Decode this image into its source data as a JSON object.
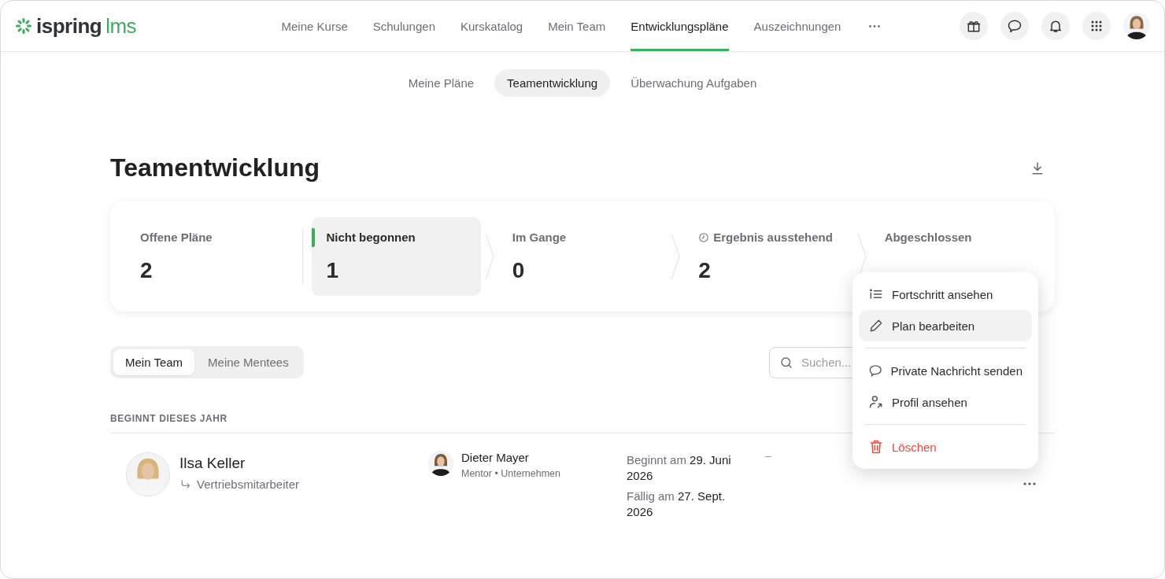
{
  "logo": {
    "brand": "ispring",
    "product": "lms"
  },
  "nav": [
    {
      "label": "Meine Kurse",
      "selected": false
    },
    {
      "label": "Schulungen",
      "selected": false
    },
    {
      "label": "Kurskatalog",
      "selected": false
    },
    {
      "label": "Mein Team",
      "selected": false
    },
    {
      "label": "Entwicklungspläne",
      "selected": true
    },
    {
      "label": "Auszeichnungen",
      "selected": false
    }
  ],
  "subtabs": [
    {
      "label": "Meine Pläne",
      "selected": false
    },
    {
      "label": "Teamentwicklung",
      "selected": true
    },
    {
      "label": "Überwachung Aufgaben",
      "selected": false
    }
  ],
  "title": "Teamentwicklung",
  "stats": [
    {
      "label": "Offene Pläne",
      "value": "2",
      "kind": "total",
      "selected": false
    },
    {
      "label": "Nicht begonnen",
      "value": "1",
      "kind": "step",
      "selected": true
    },
    {
      "label": "Im Gange",
      "value": "0",
      "kind": "step",
      "selected": false
    },
    {
      "label": "Ergebnis ausstehend",
      "value": "2",
      "kind": "pending",
      "selected": false
    },
    {
      "label": "Abgeschlossen",
      "kind": "step",
      "selected": false
    }
  ],
  "segments": [
    {
      "label": "Mein Team",
      "selected": true
    },
    {
      "label": "Meine Mentees",
      "selected": false
    }
  ],
  "search": {
    "placeholder": "Suchen..."
  },
  "section_heading": "BEGINNT DIESES JAHR",
  "rows": [
    {
      "name": "Ilsa Keller",
      "position": "Vertriebsmitarbeiter",
      "mentor": {
        "name": "Dieter Mayer",
        "role": "Mentor",
        "separator": "•",
        "scope": "Unternehmen"
      },
      "start_label": "Beginnt am",
      "start_date": "29. Juni 2026",
      "due_label": "Fällig am",
      "due_date": "27. Sept. 2026",
      "column_5": "–"
    }
  ],
  "menu": {
    "groups": [
      [
        {
          "label": "Fortschritt ansehen",
          "kind": "progress",
          "hovered": false
        },
        {
          "label": "Plan bearbeiten",
          "kind": "edit",
          "hovered": true
        }
      ],
      [
        {
          "label": "Private Nachricht senden",
          "kind": "message",
          "hovered": false
        },
        {
          "label": "Profil ansehen",
          "kind": "profile",
          "hovered": false
        }
      ],
      [
        {
          "label": "Löschen",
          "kind": "delete",
          "hovered": false
        }
      ]
    ]
  }
}
